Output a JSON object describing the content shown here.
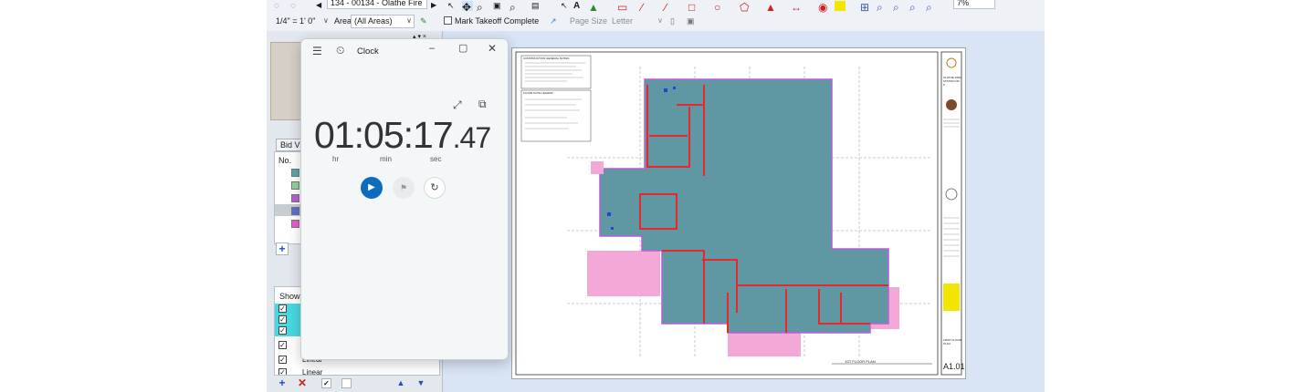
{
  "toolbar_top": {
    "page_selector": "134 - 00134 - Olathe Fire",
    "zoom_value": "7%"
  },
  "toolbar2": {
    "scale": "1/4\" = 1' 0\"",
    "area_label": "Area",
    "area_value": "(All Areas)",
    "mark_takeoff_label": "Mark Takeoff Complete",
    "page_size_label": "Page Size",
    "page_size_value": "Letter"
  },
  "left_panel": {
    "bid_tab": "Bid Vi",
    "no_header": "No.",
    "show_header": "Show",
    "rows": [
      {
        "label": "",
        "checked": true,
        "highlight": true
      },
      {
        "label": "",
        "checked": true,
        "highlight": true
      },
      {
        "label": "",
        "checked": true,
        "highlight": true
      },
      {
        "label": "",
        "checked": true,
        "highlight": false
      },
      {
        "label": "Linear",
        "checked": true,
        "highlight": false
      },
      {
        "label": "Linear",
        "checked": true,
        "highlight": false
      }
    ],
    "swatch_colors": [
      "#5aa7a6",
      "#8fd39b",
      "#b660d8",
      "#5b6fd8",
      "#f05ad0"
    ]
  },
  "clock": {
    "title": "Clock",
    "hours": "01",
    "minutes": "05",
    "seconds": "17",
    "hundredths": ".47",
    "unit_hr": "hr",
    "unit_min": "min",
    "unit_sec": "sec",
    "accent": "#0f6cbd"
  },
  "sheet": {
    "title_block_name": "OLATHE FIRE STATION NO. 5",
    "sheet_number": "A1.01",
    "plan_title": "1ST FLOOR PLAN",
    "notes_heading_1": "CONSTRUCTION GENERAL NOTES",
    "notes_heading_2": "FLOOR NOTE LEGEND",
    "sheet_title": "FIRST FLOOR PLAN",
    "colors": {
      "area_fill": "#5f98a2",
      "wall": "#e8262e",
      "pink": "#f4a8d8",
      "purple": "#b65fd6"
    }
  }
}
